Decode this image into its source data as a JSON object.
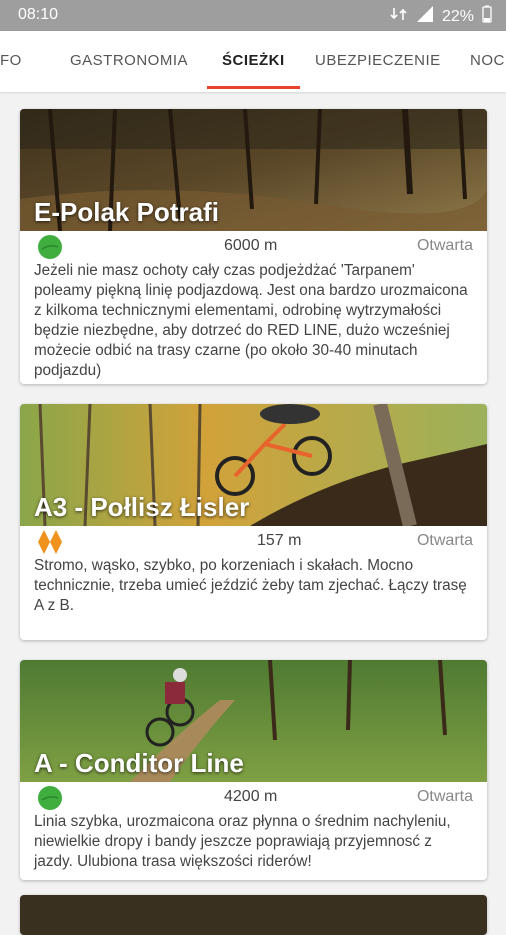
{
  "status_bar": {
    "time": "08:10",
    "battery": "22%"
  },
  "tabs": [
    {
      "label": "INFO"
    },
    {
      "label": "GASTRONOMIA"
    },
    {
      "label": "ŚCIEŻKI"
    },
    {
      "label": "UBEZPIECZENIE"
    },
    {
      "label": "NOC"
    }
  ],
  "active_tab": "ŚCIEŻKI",
  "trails": [
    {
      "name": "E-Polak Potrafi",
      "distance": "6000 m",
      "status": "Otwarta",
      "difficulty_icon": "green-circle-icon",
      "description": "Jeżeli nie masz ochoty cały czas podjeżdżać 'Tarpanem' poleamy piękną linię podjazdową. Jest ona bardzo urozmaicona z kilkoma technicznymi elementami, odrobinę wytrzymałości będzie niezbędne, aby dotrzeć do RED LINE, dużo wcześniej możecie odbić na trasy czarne (po około 30-40 minutach podjazdu)"
    },
    {
      "name": "A3 - Połlisz Łisler",
      "distance": "157 m",
      "status": "Otwarta",
      "difficulty_icon": "orange-double-diamond-icon",
      "description": "Stromo, wąsko, szybko, po korzeniach i skałach. Mocno technicznie, trzeba umieć jeździć żeby tam zjechać. Łączy trasę A z B."
    },
    {
      "name": "A - Conditor Line",
      "distance": "4200 m",
      "status": "Otwarta",
      "difficulty_icon": "green-circle-icon",
      "description": "Linia szybka, urozmaicona oraz płynna o średnim nachyleniu, niewielkie dropy i bandy jeszcze poprawiają przyjemnosć z jazdy. Ulubiona trasa większości riderów!"
    }
  ],
  "colors": {
    "accent": "#e8412c",
    "easy": "#3fae3f",
    "hard": "#f0921e"
  }
}
